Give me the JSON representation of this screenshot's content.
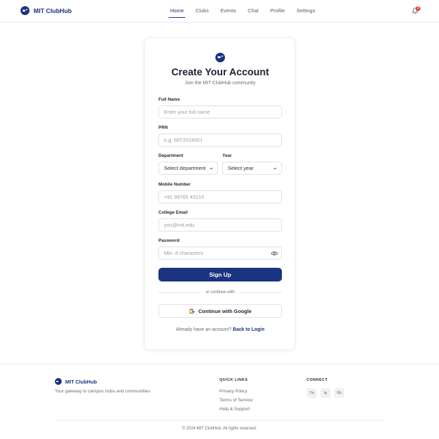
{
  "brand": {
    "name": "MIT ClubHub"
  },
  "nav": {
    "items": [
      "Home",
      "Clubs",
      "Events",
      "Chat",
      "Profile",
      "Settings"
    ],
    "active": "Home"
  },
  "notifications": {
    "count": "3"
  },
  "card": {
    "title": "Create Your Account",
    "subtitle": "Join the MIT ClubHub community",
    "fields": {
      "full_name": {
        "label": "Full Name",
        "placeholder": "Enter your full name"
      },
      "prn": {
        "label": "PRN",
        "placeholder": "e.g. MIT2024001"
      },
      "department": {
        "label": "Department",
        "value": "Select department"
      },
      "year": {
        "label": "Year",
        "value": "Select year"
      },
      "mobile": {
        "label": "Mobile Number",
        "placeholder": "+91 98765 43210"
      },
      "email": {
        "label": "College Email",
        "placeholder": "you@mit.edu"
      },
      "password": {
        "label": "Password",
        "placeholder": "Min. 8 characters"
      }
    },
    "signup_label": "Sign Up",
    "divider_text": "or continue with",
    "google_label": "Continue with Google",
    "login_prompt": "Already have an account?",
    "login_link": "Back to Login"
  },
  "footer": {
    "brand": "MIT ClubHub",
    "tagline": "Your gateway to campus clubs and communities",
    "quick_links_title": "QUICK LINKS",
    "quick_links": [
      "Privacy Policy",
      "Terms of Service",
      "Help & Support"
    ],
    "connect_title": "CONNECT",
    "social": [
      "Tw",
      "Ig",
      "Gh"
    ],
    "copyright": "© 2024 MIT ClubHub. All rights reserved."
  },
  "colors": {
    "brand": "#1a3480",
    "badge": "#e53935"
  }
}
